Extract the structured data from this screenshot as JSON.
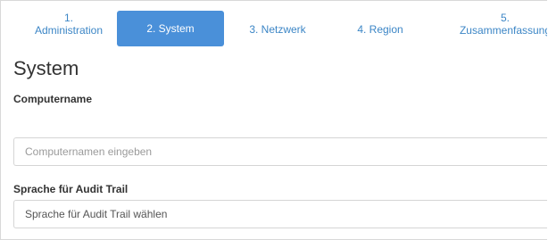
{
  "wizard": {
    "steps": [
      {
        "number": "1.",
        "label": "Administration"
      },
      {
        "label": "2. System"
      },
      {
        "label": "3. Netzwerk"
      },
      {
        "label": "4. Region"
      },
      {
        "number": "5.",
        "label": "Zusammenfassung"
      }
    ],
    "active_step_color": "#4a90d9",
    "link_color": "#3c86c6"
  },
  "section": {
    "title": "System"
  },
  "computername": {
    "label": "Computername",
    "placeholder": "Computernamen eingeben",
    "value": ""
  },
  "sprache": {
    "label": "Sprache für Audit Trail",
    "selected": "Sprache für Audit Trail wählen"
  }
}
